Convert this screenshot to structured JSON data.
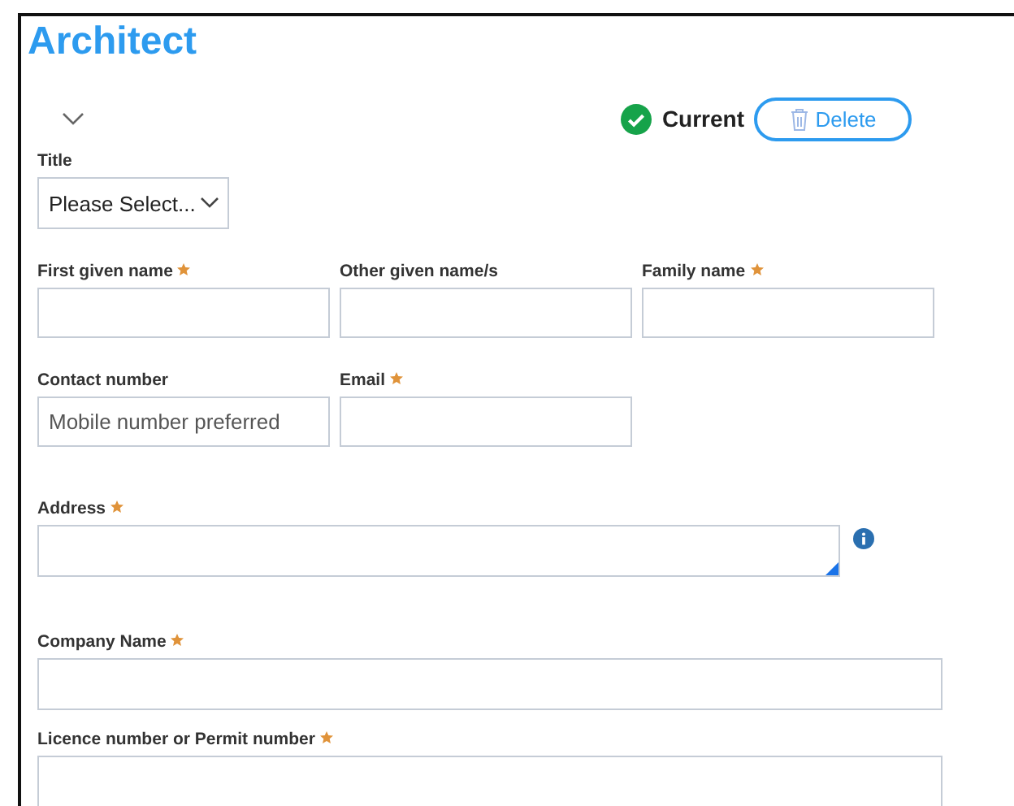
{
  "heading": "Architect",
  "status": {
    "label": "Current",
    "current": true
  },
  "delete_button": {
    "label": "Delete"
  },
  "title_field": {
    "label": "Title",
    "value": "Please Select..."
  },
  "rows": [
    {
      "fields": [
        {
          "label": "First given name",
          "required": true,
          "kind": "text"
        },
        {
          "label": "Other given name/s",
          "required": false,
          "kind": "text"
        },
        {
          "label": "Family name",
          "required": true,
          "kind": "text"
        }
      ]
    },
    {
      "fields": [
        {
          "label": "Contact number",
          "required": false,
          "kind": "text",
          "placeholder": "Mobile number preferred"
        },
        {
          "label": "Email",
          "required": true,
          "kind": "text"
        }
      ]
    },
    {
      "fields": [
        {
          "label": "Address",
          "required": true,
          "kind": "textarea",
          "info": true
        }
      ]
    },
    {
      "fields": [
        {
          "label": "Company Name",
          "required": true,
          "kind": "wide"
        }
      ]
    },
    {
      "fields": [
        {
          "label": "Licence number or Permit number",
          "required": true,
          "kind": "wide"
        }
      ]
    }
  ]
}
